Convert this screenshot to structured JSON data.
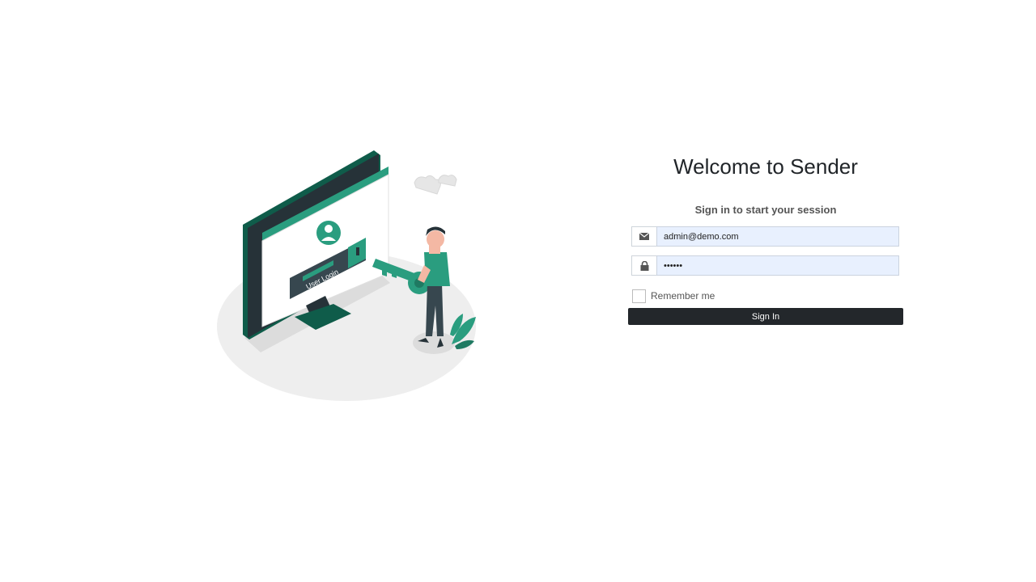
{
  "login": {
    "title": "Welcome to Sender",
    "subtitle": "Sign in to start your session",
    "email": {
      "value": "admin@demo.com",
      "icon": "envelope-icon"
    },
    "password": {
      "value": "••••••",
      "icon": "lock-icon"
    },
    "remember_label": "Remember me",
    "remember_checked": false,
    "signin_label": "Sign In"
  },
  "illustration": {
    "screen_label": "User Login",
    "description_icon": "login-illustration"
  },
  "colors": {
    "accent": "#2a9d7f",
    "accent_dark": "#0f5c4a",
    "button_bg": "#23272b",
    "input_bg": "#e8f0fe"
  }
}
